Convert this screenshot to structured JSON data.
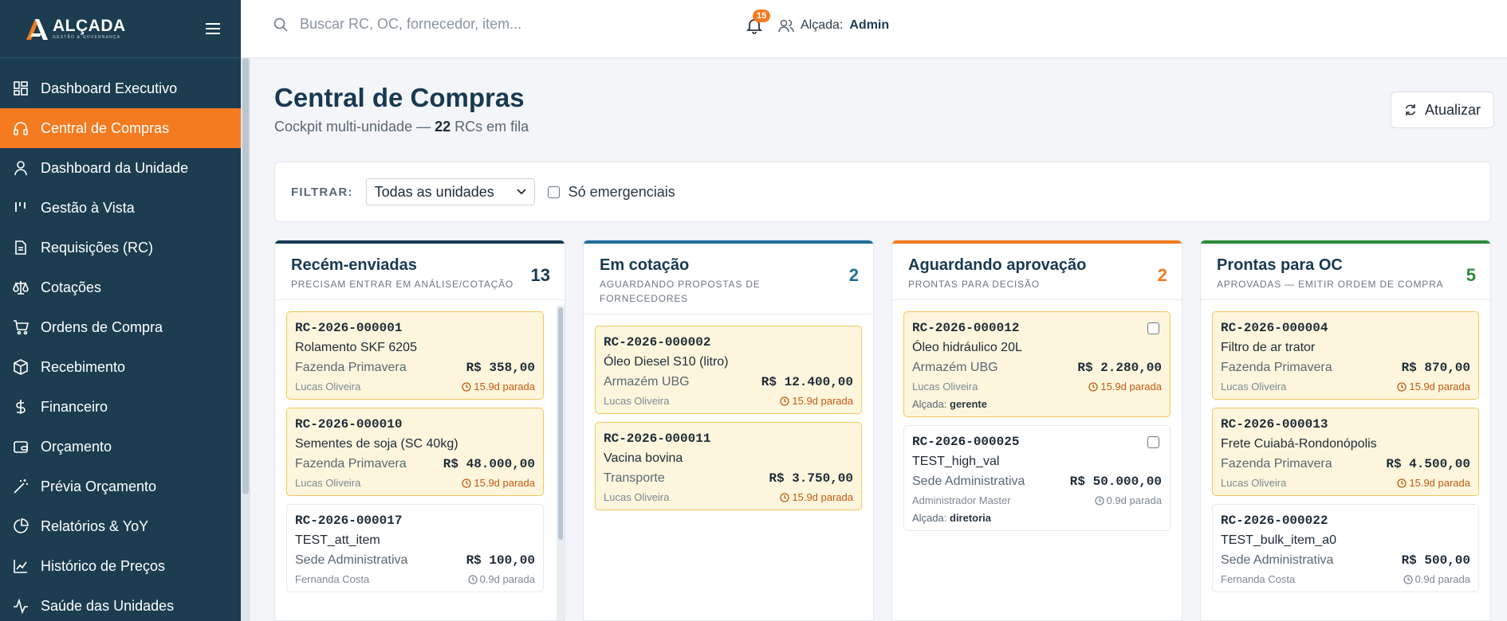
{
  "app": {
    "logo_name": "ALÇADA",
    "logo_sub": "GESTÃO & GOVERNANÇA"
  },
  "sidebar": {
    "items": [
      {
        "label": "Dashboard Executivo",
        "icon": "dashboard-grid-icon",
        "active": false
      },
      {
        "label": "Central de Compras",
        "icon": "headset-icon",
        "active": true
      },
      {
        "label": "Dashboard da Unidade",
        "icon": "user-icon",
        "active": false
      },
      {
        "label": "Gestão à Vista",
        "icon": "bars-icon",
        "active": false
      },
      {
        "label": "Requisições (RC)",
        "icon": "document-icon",
        "active": false
      },
      {
        "label": "Cotações",
        "icon": "scale-icon",
        "active": false
      },
      {
        "label": "Ordens de Compra",
        "icon": "cart-icon",
        "active": false
      },
      {
        "label": "Recebimento",
        "icon": "package-icon",
        "active": false
      },
      {
        "label": "Financeiro",
        "icon": "dollar-icon",
        "active": false
      },
      {
        "label": "Orçamento",
        "icon": "wallet-icon",
        "active": false
      },
      {
        "label": "Prévia Orçamento",
        "icon": "wand-icon",
        "active": false
      },
      {
        "label": "Relatórios & YoY",
        "icon": "pie-chart-icon",
        "active": false
      },
      {
        "label": "Histórico de Preços",
        "icon": "line-chart-icon",
        "active": false
      },
      {
        "label": "Saúde das Unidades",
        "icon": "activity-icon",
        "active": false
      }
    ]
  },
  "topbar": {
    "search_placeholder": "Buscar RC, OC, fornecedor, item...",
    "notifications_count": "15",
    "role_label": "Alçada:",
    "role_value": "Admin"
  },
  "page": {
    "title": "Central de Compras",
    "subtitle_prefix": "Cockpit multi-unidade — ",
    "subtitle_count": "22",
    "subtitle_suffix": " RCs em fila",
    "refresh_label": "Atualizar"
  },
  "filter": {
    "label": "FILTRAR:",
    "unit_select_value": "Todas as unidades",
    "emergency_label": "Só emergenciais"
  },
  "colors": {
    "brand_dark": "#1c3d50",
    "accent_orange": "#f47b20",
    "col_new": "#183a50",
    "col_quote": "#1f6f9c",
    "col_approval": "#f47b20",
    "col_ready": "#2e8b3a"
  },
  "columns": [
    {
      "title": "Recém-enviadas",
      "subtitle": "PRECISAM ENTRAR EM ANÁLISE/COTAÇÃO",
      "count": "13",
      "cards": [
        {
          "code": "RC-2026-000001",
          "item": "Rolamento SKF 6205",
          "unit": "Fazenda Primavera",
          "value": "R$ 358,00",
          "user": "Lucas Oliveira",
          "stopped": "15.9d parada",
          "urgent": true
        },
        {
          "code": "RC-2026-000010",
          "item": "Sementes de soja (SC 40kg)",
          "unit": "Fazenda Primavera",
          "value": "R$ 48.000,00",
          "user": "Lucas Oliveira",
          "stopped": "15.9d parada",
          "urgent": true
        },
        {
          "code": "RC-2026-000017",
          "item": "TEST_att_item",
          "unit": "Sede Administrativa",
          "value": "R$ 100,00",
          "user": "Fernanda Costa",
          "stopped": "0.9d parada",
          "urgent": false
        }
      ]
    },
    {
      "title": "Em cotação",
      "subtitle": "AGUARDANDO PROPOSTAS DE FORNECEDORES",
      "count": "2",
      "cards": [
        {
          "code": "RC-2026-000002",
          "item": "Óleo Diesel S10 (litro)",
          "unit": "Armazém UBG",
          "value": "R$ 12.400,00",
          "user": "Lucas Oliveira",
          "stopped": "15.9d parada",
          "urgent": true
        },
        {
          "code": "RC-2026-000011",
          "item": "Vacina bovina",
          "unit": "Transporte",
          "value": "R$ 3.750,00",
          "user": "Lucas Oliveira",
          "stopped": "15.9d parada",
          "urgent": true
        }
      ]
    },
    {
      "title": "Aguardando aprovação",
      "subtitle": "PRONTAS PARA DECISÃO",
      "count": "2",
      "cards": [
        {
          "code": "RC-2026-000012",
          "item": "Óleo hidráulico 20L",
          "unit": "Armazém UBG",
          "value": "R$ 2.280,00",
          "user": "Lucas Oliveira",
          "stopped": "15.9d parada",
          "urgent": true,
          "alcada_label": "Alçada:",
          "alcada": "gerente"
        },
        {
          "code": "RC-2026-000025",
          "item": "TEST_high_val",
          "unit": "Sede Administrativa",
          "value": "R$ 50.000,00",
          "user": "Administrador Master",
          "stopped": "0.9d parada",
          "urgent": false,
          "alcada_label": "Alçada:",
          "alcada": "diretoria"
        }
      ]
    },
    {
      "title": "Prontas para OC",
      "subtitle": "APROVADAS — EMITIR ORDEM DE COMPRA",
      "count": "5",
      "cards": [
        {
          "code": "RC-2026-000004",
          "item": "Filtro de ar trator",
          "unit": "Fazenda Primavera",
          "value": "R$ 870,00",
          "user": "Lucas Oliveira",
          "stopped": "15.9d parada",
          "urgent": true
        },
        {
          "code": "RC-2026-000013",
          "item": "Frete Cuiabá-Rondonópolis",
          "unit": "Fazenda Primavera",
          "value": "R$ 4.500,00",
          "user": "Lucas Oliveira",
          "stopped": "15.9d parada",
          "urgent": true
        },
        {
          "code": "RC-2026-000022",
          "item": "TEST_bulk_item_a0",
          "unit": "Sede Administrativa",
          "value": "R$ 500,00",
          "user": "Fernanda Costa",
          "stopped": "0.9d parada",
          "urgent": false
        }
      ]
    }
  ]
}
